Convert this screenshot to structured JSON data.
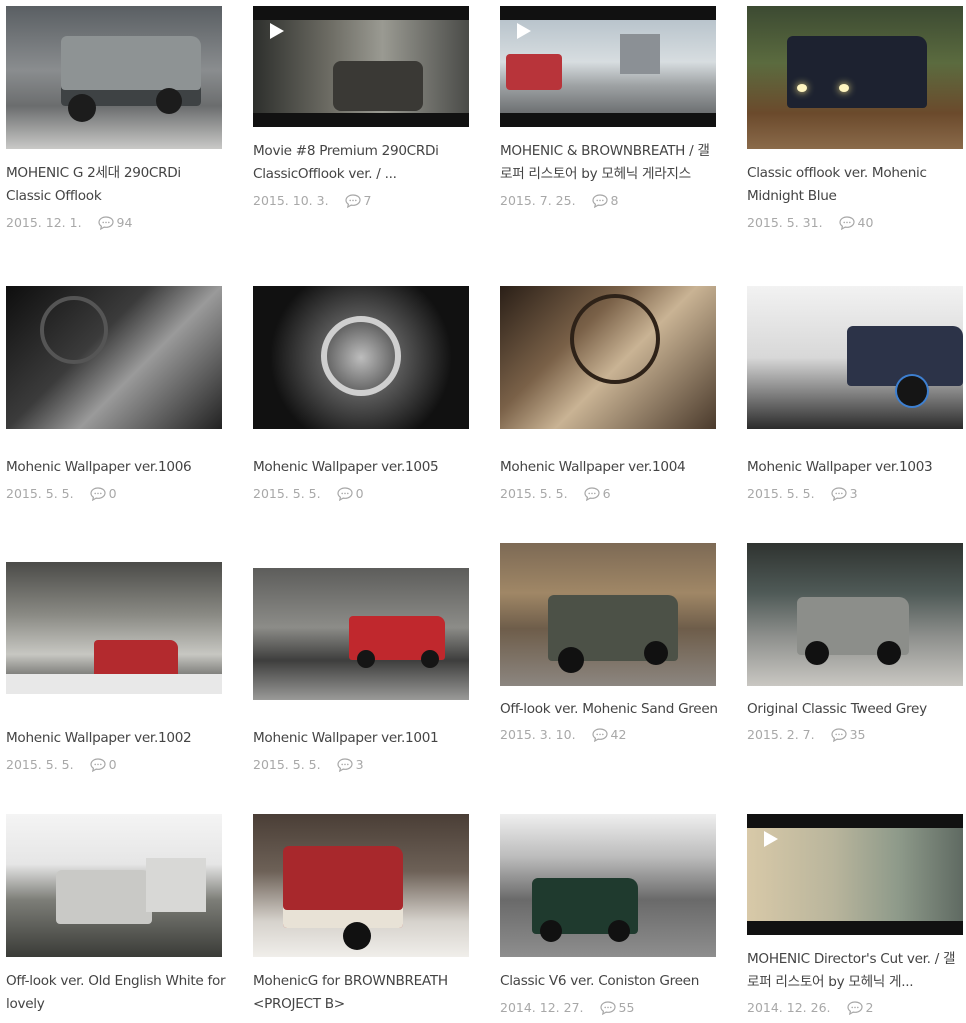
{
  "posts": [
    {
      "title": "MOHENIC G 2세대 290CRDi Classic Offlook",
      "date": "2015. 12. 1.",
      "comments": "94",
      "video": false
    },
    {
      "title": "Movie #8 Premium 290CRDi ClassicOfflook ver. / ...",
      "date": "2015. 10. 3.",
      "comments": "7",
      "video": true
    },
    {
      "title": "MOHENIC & BROWNBREATH / 갤로퍼 리스토어 by 모헤닉 게라지스",
      "date": "2015. 7. 25.",
      "comments": "8",
      "video": true
    },
    {
      "title": "Classic offlook ver. Mohenic Midnight Blue",
      "date": "2015. 5. 31.",
      "comments": "40",
      "video": false
    },
    {
      "title": "Mohenic Wallpaper ver.1006",
      "date": "2015. 5. 5.",
      "comments": "0",
      "video": false
    },
    {
      "title": "Mohenic Wallpaper ver.1005",
      "date": "2015. 5. 5.",
      "comments": "0",
      "video": false
    },
    {
      "title": "Mohenic Wallpaper ver.1004",
      "date": "2015. 5. 5.",
      "comments": "6",
      "video": false
    },
    {
      "title": "Mohenic Wallpaper ver.1003",
      "date": "2015. 5. 5.",
      "comments": "3",
      "video": false
    },
    {
      "title": "Mohenic Wallpaper ver.1002",
      "date": "2015. 5. 5.",
      "comments": "0",
      "video": false
    },
    {
      "title": "Mohenic Wallpaper ver.1001",
      "date": "2015. 5. 5.",
      "comments": "3",
      "video": false
    },
    {
      "title": "Off-look ver. Mohenic Sand Green",
      "date": "2015. 3. 10.",
      "comments": "42",
      "video": false
    },
    {
      "title": "Original Classic Tweed Grey",
      "date": "2015. 2. 7.",
      "comments": "35",
      "video": false
    },
    {
      "title": "Off-look ver. Old English White for lovely",
      "date": "",
      "comments": "",
      "video": false
    },
    {
      "title": "MohenicG for BROWNBREATH <PROJECT B>",
      "date": "",
      "comments": "",
      "video": false
    },
    {
      "title": "Classic V6 ver. Coniston Green",
      "date": "2014. 12. 27.",
      "comments": "55",
      "video": false
    },
    {
      "title": "MOHENIC Director's Cut ver. / 갤로퍼 리스토어 by 모헤닉 게...",
      "date": "2014. 12. 26.",
      "comments": "2",
      "video": true
    }
  ],
  "icons": {
    "comment": "speech-bubble-icon",
    "play": "play-icon"
  },
  "colors": {
    "meta_text": "#a8a8a8",
    "title_text": "#444444",
    "play_white": "#ffffff"
  }
}
